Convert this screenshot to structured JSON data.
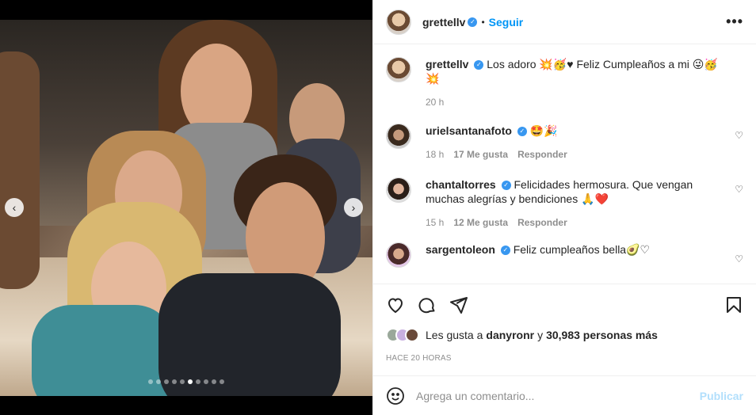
{
  "post": {
    "author": "grettellv",
    "follow_label": "Seguir",
    "separator": "•",
    "more_label": "•••"
  },
  "caption": {
    "author": "grettellv",
    "text": "Los adoro 💥🥳♥ Feliz Cumpleaños a mi 😜🥳💥",
    "time": "20 h"
  },
  "comments": [
    {
      "author": "urielsantanafoto",
      "text": "🤩🎉",
      "time": "18 h",
      "likes": "17 Me gusta",
      "reply": "Responder"
    },
    {
      "author": "chantaltorres",
      "text": "Felicidades hermosura. Que vengan muchas alegrías y bendiciones 🙏❤️",
      "time": "15 h",
      "likes": "12 Me gusta",
      "reply": "Responder"
    },
    {
      "author": "sargentoleon",
      "text": "Feliz cumpleaños bella🥑♡"
    }
  ],
  "likes": {
    "prefix": "Les gusta a",
    "user": "danyronr",
    "conj": "y",
    "count": "30,983 personas más"
  },
  "time_ago": "HACE 20 HORAS",
  "composer": {
    "placeholder": "Agrega un comentario...",
    "publish_label": "Publicar"
  },
  "carousel": {
    "slide_count": 10,
    "active_index": 5
  },
  "colors": {
    "accent": "#0095f6",
    "verified": "#3897f0",
    "publish_disabled": "#b2dffc"
  }
}
